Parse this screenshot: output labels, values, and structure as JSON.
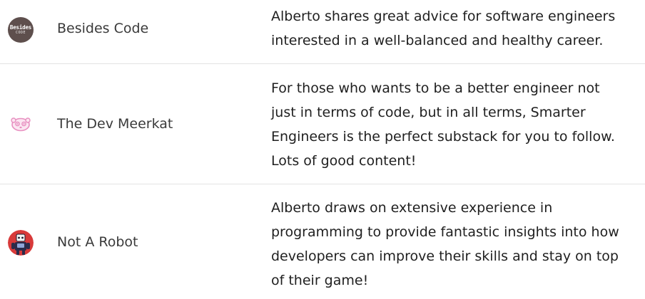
{
  "rows": [
    {
      "name": "Besides Code",
      "avatar_text_top": "Besides",
      "avatar_text_bottom": "CODE",
      "description": "Alberto shares great advice for software engineers interested in a well-balanced and healthy career."
    },
    {
      "name": "The Dev Meerkat",
      "description": "For those who wants to be a better engineer not just in terms of code, but in all terms, Smarter Engineers is the perfect substack for you to follow. Lots of good content!"
    },
    {
      "name": "Not A Robot",
      "description": "Alberto draws on extensive experience in programming to provide fantastic insights into how developers can improve their skills and stay on top of their game!"
    }
  ],
  "colors": {
    "besides_code_avatar": "#5e4f4d",
    "meerkat_pink": "#e88fc0",
    "robot_red": "#d83a3a",
    "divider": "#e3e3e3"
  }
}
